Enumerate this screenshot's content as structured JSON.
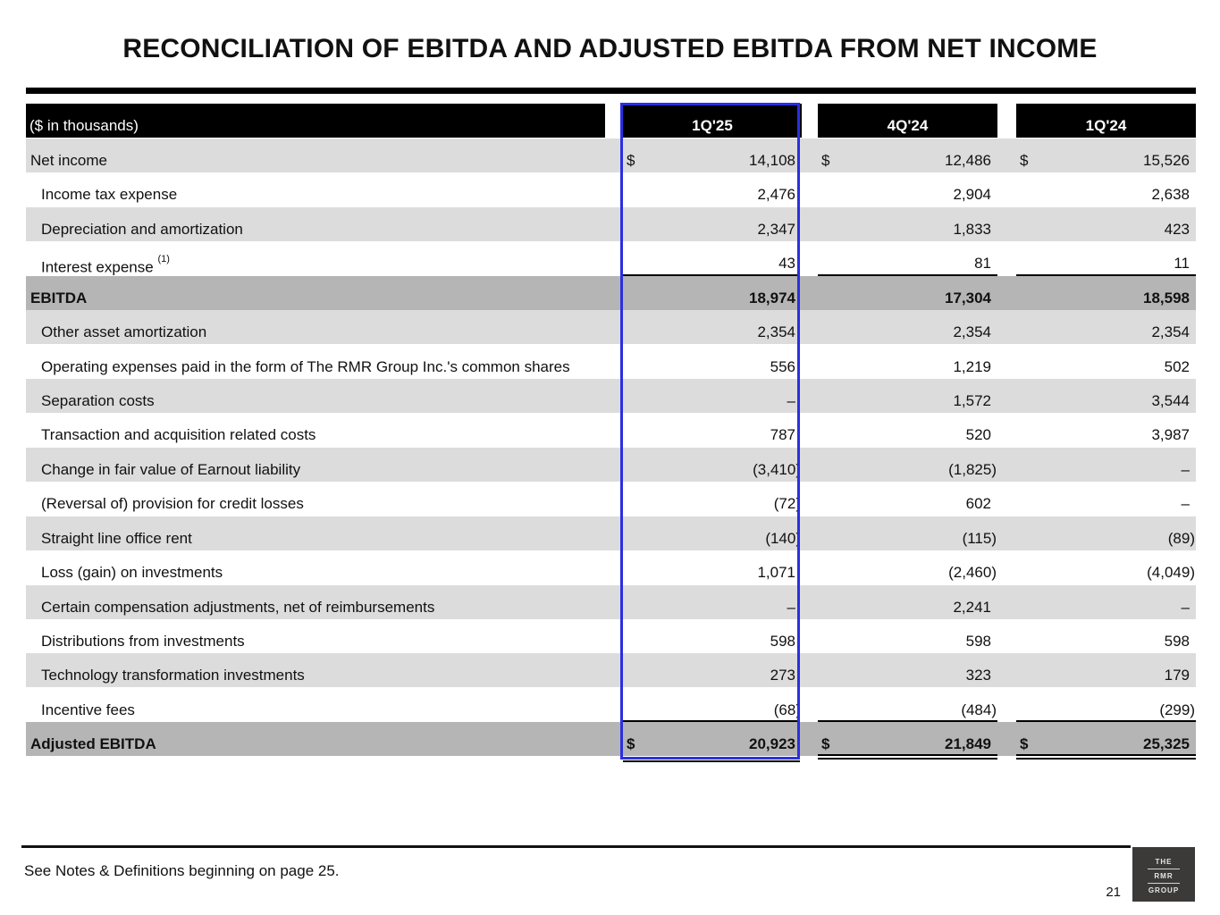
{
  "title": "RECONCILIATION OF EBITDA AND ADJUSTED EBITDA FROM NET INCOME",
  "table": {
    "unit_label": "($ in thousands)",
    "columns": [
      "1Q'25",
      "4Q'24",
      "1Q'24"
    ],
    "currency_symbol": "$",
    "rows": [
      {
        "label": "Net income",
        "values": [
          "14,108",
          "12,486",
          "15,526"
        ]
      },
      {
        "label": "Income tax expense",
        "values": [
          "2,476",
          "2,904",
          "2,638"
        ]
      },
      {
        "label": "Depreciation and amortization",
        "values": [
          "2,347",
          "1,833",
          "423"
        ]
      },
      {
        "label": "Interest expense",
        "footnote": "(1)",
        "values": [
          "43",
          "81",
          "11"
        ]
      },
      {
        "label": "EBITDA",
        "values": [
          "18,974",
          "17,304",
          "18,598"
        ]
      },
      {
        "label": "Other asset amortization",
        "values": [
          "2,354",
          "2,354",
          "2,354"
        ]
      },
      {
        "label": "Operating expenses paid in the form of The RMR Group Inc.'s common shares",
        "values": [
          "556",
          "1,219",
          "502"
        ]
      },
      {
        "label": "Separation costs",
        "values": [
          "–",
          "1,572",
          "3,544"
        ]
      },
      {
        "label": "Transaction and acquisition related costs",
        "values": [
          "787",
          "520",
          "3,987"
        ]
      },
      {
        "label": "Change in fair value of Earnout liability",
        "values": [
          "(3,410)",
          "(1,825)",
          "–"
        ]
      },
      {
        "label": "(Reversal of) provision for credit losses",
        "values": [
          "(72)",
          "602",
          "–"
        ]
      },
      {
        "label": "Straight line office rent",
        "values": [
          "(140)",
          "(115)",
          "(89)"
        ]
      },
      {
        "label": "Loss (gain) on investments",
        "values": [
          "1,071",
          "(2,460)",
          "(4,049)"
        ]
      },
      {
        "label": "Certain compensation adjustments, net of reimbursements",
        "values": [
          "–",
          "2,241",
          "–"
        ]
      },
      {
        "label": "Distributions from investments",
        "values": [
          "598",
          "598",
          "598"
        ]
      },
      {
        "label": "Technology transformation investments",
        "values": [
          "273",
          "323",
          "179"
        ]
      },
      {
        "label": "Incentive fees",
        "values": [
          "(68)",
          "(484)",
          "(299)"
        ]
      },
      {
        "label": "Adjusted EBITDA",
        "values": [
          "20,923",
          "21,849",
          "25,325"
        ]
      }
    ]
  },
  "footer": {
    "note": "See Notes & Definitions beginning on page 25.",
    "page_number": "21",
    "logo_lines": [
      "THE",
      "RMR",
      "GROUP"
    ]
  },
  "colors": {
    "header_bg": "#000000",
    "shaded_row": "#dcdcdc",
    "total_row": "#b5b5b5",
    "highlight_border": "#2b2fe0",
    "logo_bg": "#3c3a38"
  }
}
